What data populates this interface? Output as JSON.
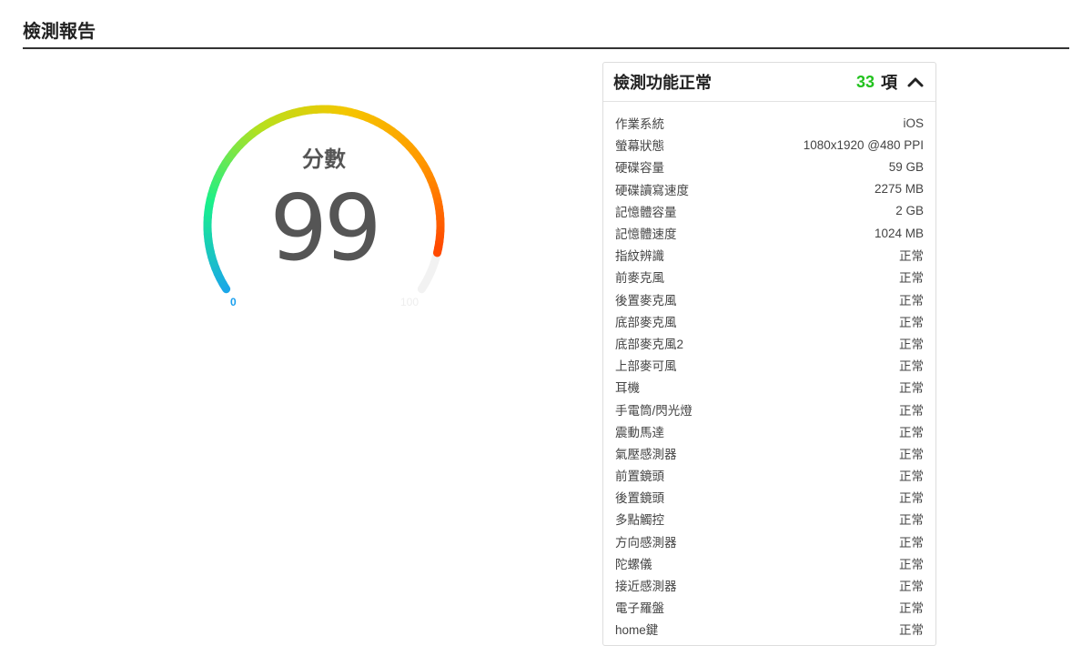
{
  "header": {
    "title": "檢測報告"
  },
  "gauge": {
    "label": "分數",
    "score": "99",
    "value": 99,
    "min": "0",
    "max": "100"
  },
  "panel": {
    "title": "檢測功能正常",
    "count": "33",
    "unit": "項",
    "rows": [
      {
        "label": "作業系統",
        "value": "iOS"
      },
      {
        "label": "螢幕狀態",
        "value": "1080x1920 @480 PPI"
      },
      {
        "label": "硬碟容量",
        "value": "59 GB"
      },
      {
        "label": "硬碟讀寫速度",
        "value": "2275 MB"
      },
      {
        "label": "記憶體容量",
        "value": "2 GB"
      },
      {
        "label": "記憶體速度",
        "value": "1024 MB"
      },
      {
        "label": "指紋辨識",
        "value": "正常"
      },
      {
        "label": "前麥克風",
        "value": "正常"
      },
      {
        "label": "後置麥克風",
        "value": "正常"
      },
      {
        "label": "底部麥克風",
        "value": "正常"
      },
      {
        "label": "底部麥克風2",
        "value": "正常"
      },
      {
        "label": "上部麥可風",
        "value": "正常"
      },
      {
        "label": "耳機",
        "value": "正常"
      },
      {
        "label": "手電筒/閃光燈",
        "value": "正常"
      },
      {
        "label": "震動馬達",
        "value": "正常"
      },
      {
        "label": "氣壓感測器",
        "value": "正常"
      },
      {
        "label": "前置鏡頭",
        "value": "正常"
      },
      {
        "label": "後置鏡頭",
        "value": "正常"
      },
      {
        "label": "多點觸控",
        "value": "正常"
      },
      {
        "label": "方向感測器",
        "value": "正常"
      },
      {
        "label": "陀螺儀",
        "value": "正常"
      },
      {
        "label": "接近感測器",
        "value": "正常"
      },
      {
        "label": "電子羅盤",
        "value": "正常"
      },
      {
        "label": "home鍵",
        "value": "正常"
      }
    ]
  },
  "colors": {
    "count": "#22c21e",
    "gauge_stops": [
      "#1aa7e8",
      "#19f08a",
      "#b5e01e",
      "#f5c600",
      "#ff9a00",
      "#ff4a00"
    ],
    "track": "#f2f2f2"
  }
}
